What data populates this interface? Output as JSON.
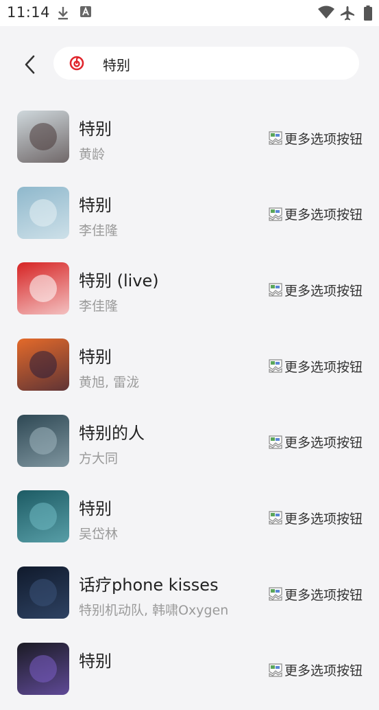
{
  "status": {
    "time": "11:14"
  },
  "search": {
    "query": "特别"
  },
  "more_label": "更多选项按钮",
  "songs": [
    {
      "title": "特别",
      "artist": "黄龄",
      "cover_bg": "#cfd8dc",
      "cover_fg": "#4a3b3b"
    },
    {
      "title": "特别",
      "artist": "李佳隆",
      "cover_bg": "#8fb8cc",
      "cover_fg": "#e6f0f4"
    },
    {
      "title": "特别 (live)",
      "artist": "李佳隆",
      "cover_bg": "#d62424",
      "cover_fg": "#ffffff"
    },
    {
      "title": "特别",
      "artist": "黄旭, 雷泷",
      "cover_bg": "#e46a2a",
      "cover_fg": "#2a1e3a"
    },
    {
      "title": "特别的人",
      "artist": "方大同",
      "cover_bg": "#2e4854",
      "cover_fg": "#9fb4bd"
    },
    {
      "title": "特别",
      "artist": "吴岱林",
      "cover_bg": "#1d5b64",
      "cover_fg": "#6fb9c2"
    },
    {
      "title": "话疗phone kisses",
      "artist": "特别机动队, 韩啸Oxygen",
      "cover_bg": "#101a2c",
      "cover_fg": "#3a5278"
    },
    {
      "title": "特别",
      "artist": "",
      "cover_bg": "#1b1b24",
      "cover_fg": "#7a5cc4"
    }
  ]
}
